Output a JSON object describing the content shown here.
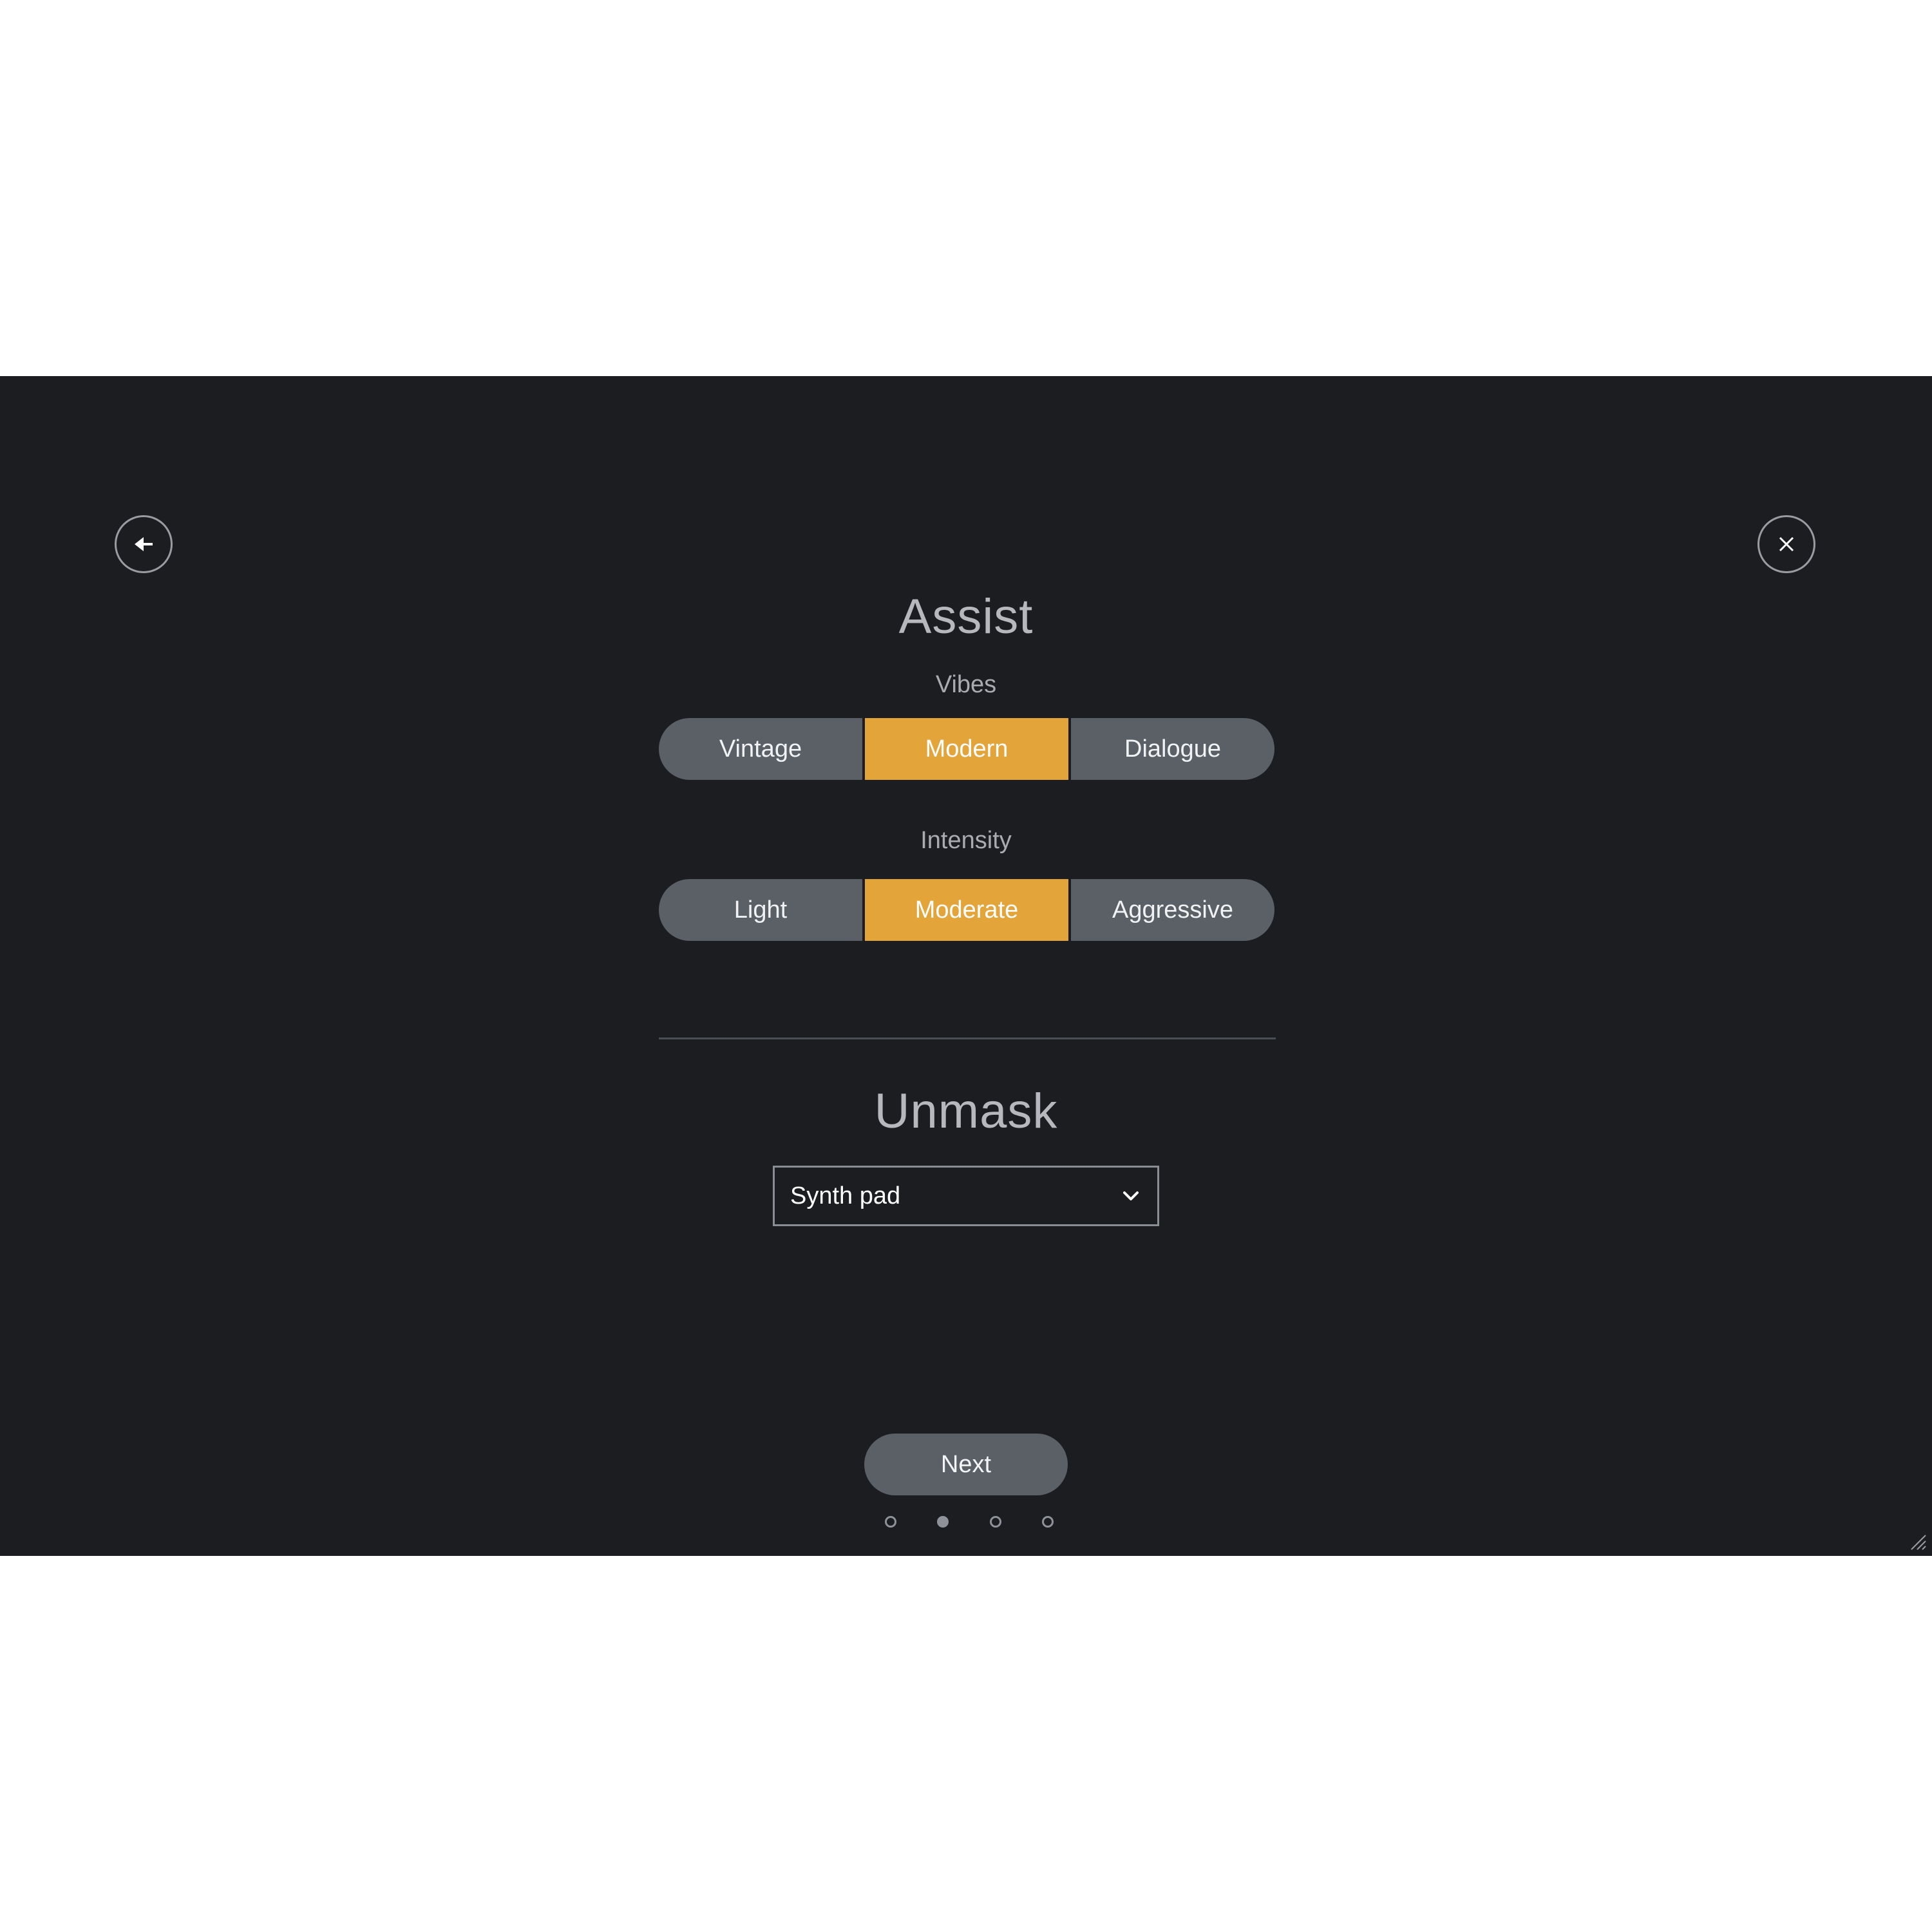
{
  "header": {
    "back_icon": "arrow-left-icon",
    "close_icon": "close-icon"
  },
  "assist": {
    "title": "Assist",
    "vibes": {
      "label": "Vibes",
      "options": [
        "Vintage",
        "Modern",
        "Dialogue"
      ],
      "selected": "Modern"
    },
    "intensity": {
      "label": "Intensity",
      "options": [
        "Light",
        "Moderate",
        "Aggressive"
      ],
      "selected": "Moderate"
    }
  },
  "unmask": {
    "title": "Unmask",
    "select_value": "Synth pad",
    "select_icon": "chevron-down-icon"
  },
  "footer": {
    "next_label": "Next",
    "pagination": {
      "total": 4,
      "current": 2
    }
  },
  "colors": {
    "background": "#1c1d21",
    "accent": "#e3a43a",
    "button": "#5b5f66"
  }
}
